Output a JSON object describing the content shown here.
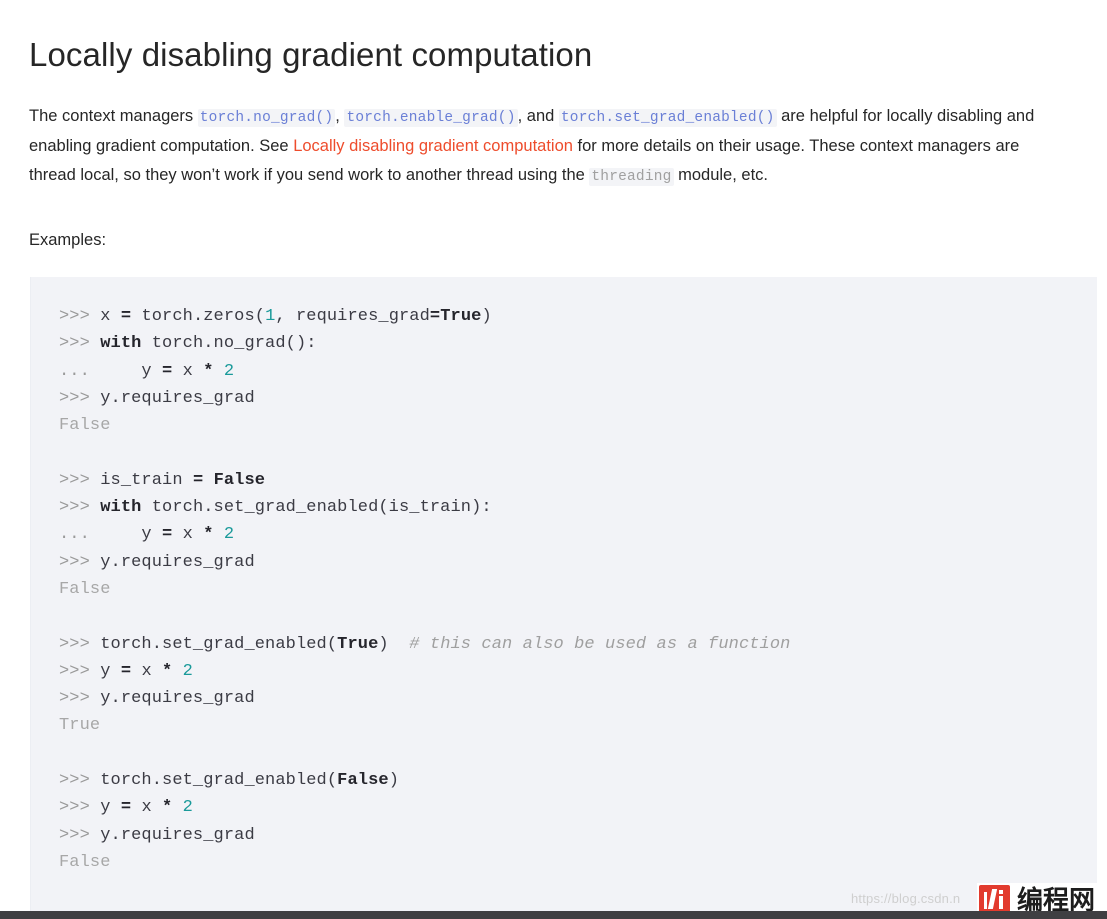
{
  "page": {
    "title": "Locally disabling gradient computation",
    "examples_label": "Examples:"
  },
  "paragraph": {
    "seg1": "The context managers ",
    "code1": "torch.no_grad()",
    "seg2": ", ",
    "code2": "torch.enable_grad()",
    "seg3": ", and ",
    "code3": "torch.set_grad_enabled()",
    "seg4": " are helpful for locally disabling and enabling gradient computation. See ",
    "link_text": "Locally disabling gradient computation",
    "seg5": " for more details on their usage. These context managers are thread local, so they won’t work if you send work to another thread using the ",
    "code4": "threading",
    "seg6": " module, etc."
  },
  "code_block": {
    "lines": [
      [
        {
          "t": "prompt",
          "s": ">>> "
        },
        {
          "t": "plain",
          "s": "x "
        },
        {
          "t": "op",
          "s": "="
        },
        {
          "t": "plain",
          "s": " torch.zeros("
        },
        {
          "t": "num",
          "s": "1"
        },
        {
          "t": "plain",
          "s": ", requires_grad"
        },
        {
          "t": "op",
          "s": "="
        },
        {
          "t": "bool",
          "s": "True"
        },
        {
          "t": "plain",
          "s": ")"
        }
      ],
      [
        {
          "t": "prompt",
          "s": ">>> "
        },
        {
          "t": "kw",
          "s": "with"
        },
        {
          "t": "plain",
          "s": " torch.no_grad():"
        }
      ],
      [
        {
          "t": "prompt",
          "s": "... "
        },
        {
          "t": "plain",
          "s": "    y "
        },
        {
          "t": "op",
          "s": "="
        },
        {
          "t": "plain",
          "s": " x "
        },
        {
          "t": "op",
          "s": "*"
        },
        {
          "t": "plain",
          "s": " "
        },
        {
          "t": "num",
          "s": "2"
        }
      ],
      [
        {
          "t": "prompt",
          "s": ">>> "
        },
        {
          "t": "plain",
          "s": "y.requires_grad"
        }
      ],
      [
        {
          "t": "out",
          "s": "False"
        }
      ],
      [],
      [
        {
          "t": "prompt",
          "s": ">>> "
        },
        {
          "t": "plain",
          "s": "is_train "
        },
        {
          "t": "op",
          "s": "="
        },
        {
          "t": "plain",
          "s": " "
        },
        {
          "t": "bool",
          "s": "False"
        }
      ],
      [
        {
          "t": "prompt",
          "s": ">>> "
        },
        {
          "t": "kw",
          "s": "with"
        },
        {
          "t": "plain",
          "s": " torch.set_grad_enabled(is_train):"
        }
      ],
      [
        {
          "t": "prompt",
          "s": "... "
        },
        {
          "t": "plain",
          "s": "    y "
        },
        {
          "t": "op",
          "s": "="
        },
        {
          "t": "plain",
          "s": " x "
        },
        {
          "t": "op",
          "s": "*"
        },
        {
          "t": "plain",
          "s": " "
        },
        {
          "t": "num",
          "s": "2"
        }
      ],
      [
        {
          "t": "prompt",
          "s": ">>> "
        },
        {
          "t": "plain",
          "s": "y.requires_grad"
        }
      ],
      [
        {
          "t": "out",
          "s": "False"
        }
      ],
      [],
      [
        {
          "t": "prompt",
          "s": ">>> "
        },
        {
          "t": "plain",
          "s": "torch.set_grad_enabled("
        },
        {
          "t": "bool",
          "s": "True"
        },
        {
          "t": "plain",
          "s": ")  "
        },
        {
          "t": "comment",
          "s": "# this can also be used as a function"
        }
      ],
      [
        {
          "t": "prompt",
          "s": ">>> "
        },
        {
          "t": "plain",
          "s": "y "
        },
        {
          "t": "op",
          "s": "="
        },
        {
          "t": "plain",
          "s": " x "
        },
        {
          "t": "op",
          "s": "*"
        },
        {
          "t": "plain",
          "s": " "
        },
        {
          "t": "num",
          "s": "2"
        }
      ],
      [
        {
          "t": "prompt",
          "s": ">>> "
        },
        {
          "t": "plain",
          "s": "y.requires_grad"
        }
      ],
      [
        {
          "t": "out",
          "s": "True"
        }
      ],
      [],
      [
        {
          "t": "prompt",
          "s": ">>> "
        },
        {
          "t": "plain",
          "s": "torch.set_grad_enabled("
        },
        {
          "t": "bool",
          "s": "False"
        },
        {
          "t": "plain",
          "s": ")"
        }
      ],
      [
        {
          "t": "prompt",
          "s": ">>> "
        },
        {
          "t": "plain",
          "s": "y "
        },
        {
          "t": "op",
          "s": "="
        },
        {
          "t": "plain",
          "s": " x "
        },
        {
          "t": "op",
          "s": "*"
        },
        {
          "t": "plain",
          "s": " "
        },
        {
          "t": "num",
          "s": "2"
        }
      ],
      [
        {
          "t": "prompt",
          "s": ">>> "
        },
        {
          "t": "plain",
          "s": "y.requires_grad"
        }
      ],
      [
        {
          "t": "out",
          "s": "False"
        }
      ]
    ]
  },
  "watermark": {
    "url": "https://blog.csdn.n",
    "brand_text": "编程网"
  },
  "colors": {
    "link_red": "#ee4c2c",
    "inline_code_blue": "#6a7fd6",
    "code_bg": "#f2f3f7",
    "number_teal": "#1a9a9a",
    "brand_red": "#e23b2e"
  }
}
